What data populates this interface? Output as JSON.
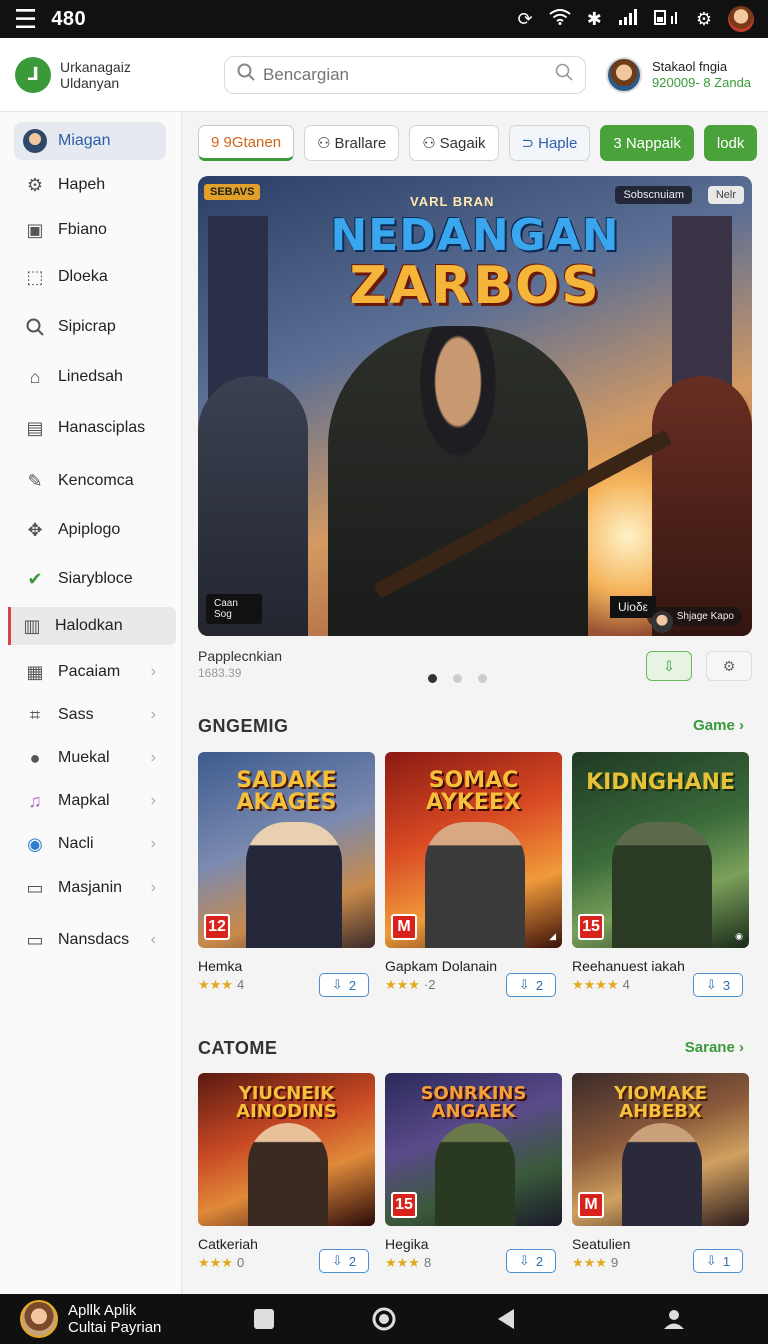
{
  "statusbar": {
    "clock": "480"
  },
  "header": {
    "brand_line1": "Urkanagaiz",
    "brand_line2": "Uldanyan",
    "search_placeholder": "Bencargian",
    "user_name": "Stakaol fngia",
    "user_sub": "920009- 8 Zanda"
  },
  "sidebar": {
    "items": [
      {
        "label": "Miagan"
      },
      {
        "label": "Hapeh"
      },
      {
        "label": "Fbiano"
      },
      {
        "label": "Dloeka"
      },
      {
        "label": "Sipicrap"
      },
      {
        "label": "Linedsah"
      },
      {
        "label": "Hanasciplas"
      },
      {
        "label": "Kencomca"
      },
      {
        "label": "Apiplogo"
      },
      {
        "label": "Siarybloce"
      },
      {
        "label": "Halodkan"
      },
      {
        "label": "Pacaiam"
      },
      {
        "label": "Sass"
      },
      {
        "label": "Muekal"
      },
      {
        "label": "Mapkal"
      },
      {
        "label": "Nacli"
      },
      {
        "label": "Masjanin"
      },
      {
        "label": "Nansdacs"
      }
    ]
  },
  "filters": [
    "9 9Gtanen",
    "Brallare",
    "Sagaik",
    "Haple",
    "3 Nappaik",
    "lodk"
  ],
  "hero": {
    "tag_left": "SEBAVS",
    "tag_mid": "Sobscnuiam",
    "tag_new": "Nelr",
    "title_small": "VARL BRAN",
    "title_line1": "NEDANGAN",
    "title_line2": "ZARBOS",
    "badge_bl": "Caan Sog",
    "badge_br": "Uioδε",
    "badge_user": "Shjage Kapo",
    "caption": "Papplecnkian",
    "caption_sub": "1683.39"
  },
  "section1": {
    "title": "GNGEMIG",
    "more": "Game",
    "cards": [
      {
        "art_title": "SADAKE AKAGES",
        "rating": "12",
        "name": "Hemka",
        "stars": "★★★",
        "score": "4",
        "dl": "2"
      },
      {
        "art_title": "SOMAC AYKEEX",
        "rating": "M",
        "name": "Gapkam Dolanain",
        "stars": "★★★",
        "score": "·2",
        "dl": "2"
      },
      {
        "art_title": "KIDNGHANE",
        "rating": "15",
        "name": "Reehanuest iakah",
        "stars": "★★★★",
        "score": "4",
        "dl": "3"
      }
    ]
  },
  "section2": {
    "title": "CATOME",
    "more": "Sarane",
    "cards": [
      {
        "art_title": "YIUCNEIK AINODINS",
        "rating": "",
        "name": "Catkeriah",
        "stars": "★★★",
        "score": "0",
        "dl": "2"
      },
      {
        "art_title": "SONRKINS ANGAEK",
        "rating": "15",
        "name": "Hegika",
        "stars": "★★★",
        "score": "8",
        "dl": "2"
      },
      {
        "art_title": "YIOMAKE AHBEBX",
        "rating": "M",
        "name": "Seatulien",
        "stars": "★★★",
        "score": "9",
        "dl": "1"
      }
    ]
  },
  "bottombar": {
    "line1": "Apllk Aplik",
    "line2": "Cultai Payrian"
  }
}
